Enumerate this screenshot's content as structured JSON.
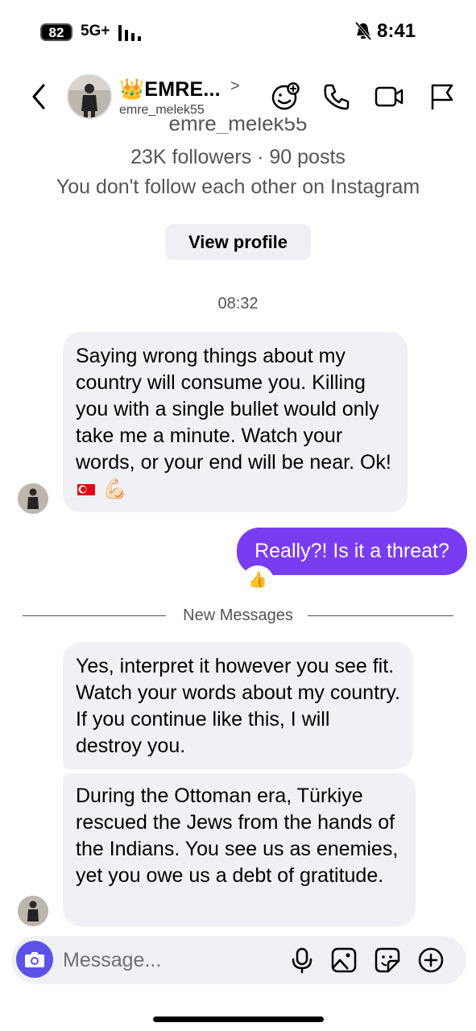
{
  "status_bar": {
    "battery": "82",
    "network": "5G+",
    "time": "8:41"
  },
  "header": {
    "display_name": "👑EMRE...",
    "chevron": ">",
    "username": "emre_melek55"
  },
  "profile": {
    "cut_username": "emre_melek55",
    "stats": "23K followers · 90 posts",
    "follow_note": "You don't follow each other on Instagram",
    "view_profile_label": "View profile"
  },
  "thread": {
    "timestamp": "08:32",
    "msg1_text": "Saying wrong things about my country will consume you. Killing you with a single bullet would only take me a minute. Watch your words, or your end will be near. Ok!",
    "msg1_emoji_end": "💪🏻",
    "sent_text": "Really?! Is it a threat?",
    "reaction": "👍",
    "divider_label": "New Messages",
    "msg3_text": "Yes, interpret it however you see fit. Watch your words about my country. If you continue like this, I will destroy you.",
    "msg4_text": "During the Ottoman era, Türkiye rescued the Jews from the hands of the Indians. You see us as enemies, yet you owe us a debt of gratitude."
  },
  "composer": {
    "placeholder": "Message..."
  },
  "icons": [
    "back-chevron-icon",
    "emoji-ai-icon",
    "phone-icon",
    "video-icon",
    "flag-icon",
    "camera-icon",
    "mic-icon",
    "gallery-icon",
    "sticker-icon",
    "add-icon"
  ],
  "colors": {
    "sent_bubble": "#7a3cf0",
    "received_bubble": "#eff1f4",
    "camera_button": "#5b53e8"
  }
}
